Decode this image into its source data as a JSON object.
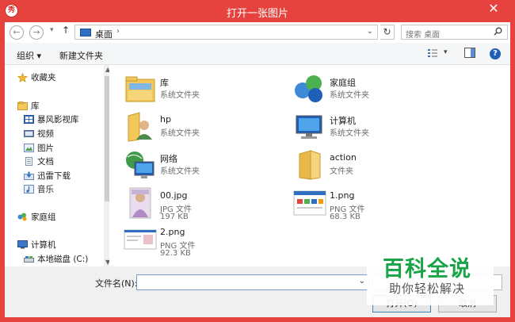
{
  "window": {
    "title": "打开一张图片",
    "app_icon_text": "秀",
    "close_glyph": "✕"
  },
  "navigation": {
    "back_glyph": "←",
    "forward_glyph": "→",
    "recent_glyph": "▾",
    "up_glyph": "↑",
    "address_location": "桌面",
    "address_separator": "›",
    "address_dropdown_glyph": "⌄",
    "refresh_glyph": "↻",
    "search_placeholder": "搜索 桌面",
    "search_icon": "search-icon"
  },
  "toolbar": {
    "organize_label": "组织 ▾",
    "new_folder_label": "新建文件夹",
    "view_menu_glyph": "▾",
    "help_glyph": "?"
  },
  "sidebar": {
    "items": [
      {
        "label": "收藏夹",
        "icon": "star-icon"
      },
      {
        "label": "库",
        "icon": "library-icon"
      },
      {
        "label": "暴风影视库",
        "icon": "video-library-icon"
      },
      {
        "label": "视频",
        "icon": "video-icon"
      },
      {
        "label": "图片",
        "icon": "pictures-icon"
      },
      {
        "label": "文档",
        "icon": "documents-icon"
      },
      {
        "label": "迅雷下载",
        "icon": "download-icon"
      },
      {
        "label": "音乐",
        "icon": "music-icon"
      },
      {
        "label": "家庭组",
        "icon": "homegroup-icon"
      },
      {
        "label": "计算机",
        "icon": "computer-icon"
      },
      {
        "label": "本地磁盘 (C:)",
        "icon": "drive-icon"
      }
    ]
  },
  "files": [
    {
      "name": "库",
      "type": "系统文件夹",
      "size": "",
      "icon": "library-folder-icon"
    },
    {
      "name": "家庭组",
      "type": "系统文件夹",
      "size": "",
      "icon": "homegroup-icon"
    },
    {
      "name": "hp",
      "type": "系统文件夹",
      "size": "",
      "icon": "user-folder-icon"
    },
    {
      "name": "计算机",
      "type": "系统文件夹",
      "size": "",
      "icon": "computer-icon"
    },
    {
      "name": "网络",
      "type": "系统文件夹",
      "size": "",
      "icon": "network-icon"
    },
    {
      "name": "action",
      "type": "文件夹",
      "size": "",
      "icon": "folder-icon"
    },
    {
      "name": "00.jpg",
      "type": "JPG 文件",
      "size": "197 KB",
      "icon": "image-thumbnail"
    },
    {
      "name": "1.png",
      "type": "PNG 文件",
      "size": "68.3 KB",
      "icon": "image-thumbnail"
    },
    {
      "name": "2.png",
      "type": "PNG 文件",
      "size": "92.3 KB",
      "icon": "image-thumbnail"
    }
  ],
  "bottom": {
    "filename_label": "文件名(N):",
    "filename_value": "",
    "filename_dropdown_glyph": "⌄",
    "open_button": "打开(O)",
    "cancel_button": "取消"
  },
  "watermark": {
    "title": "百科全说",
    "subtitle": "助你轻松解决"
  },
  "colors": {
    "title_bar": "#e6433f",
    "accent_blue": "#1f5fb8",
    "watermark_green": "#19a447"
  }
}
